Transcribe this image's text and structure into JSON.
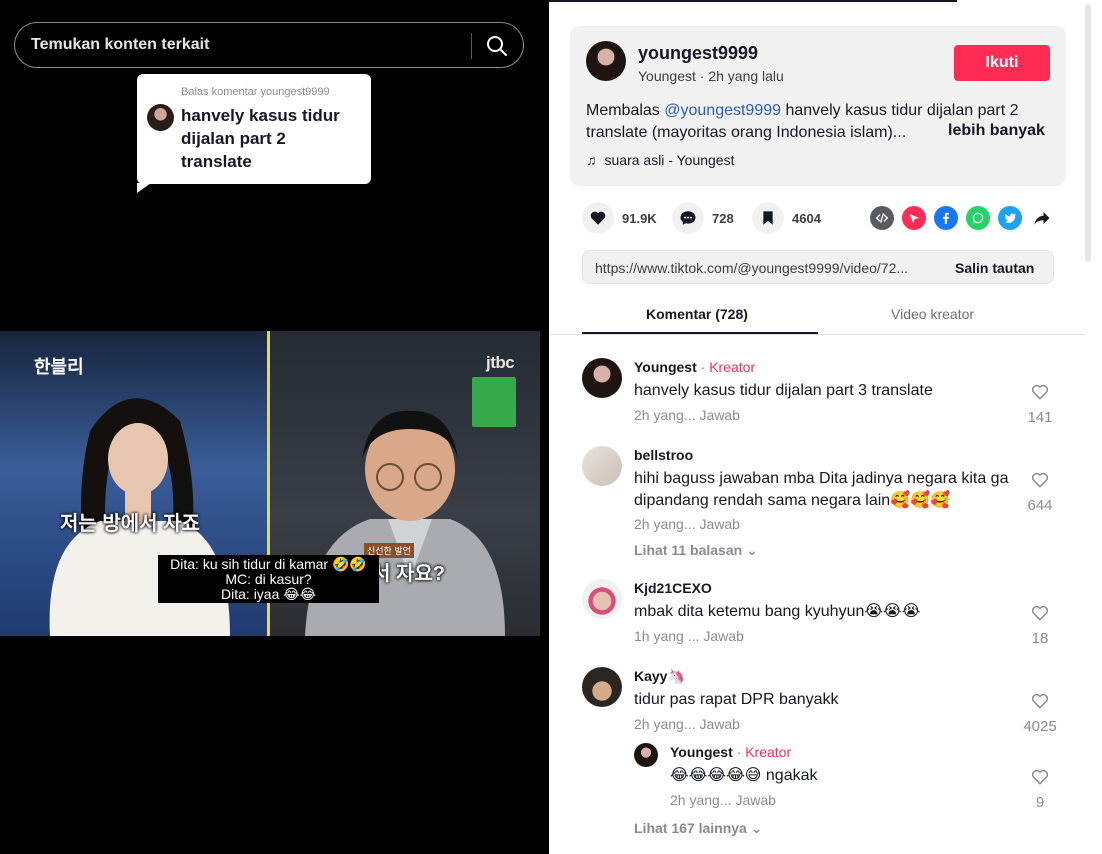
{
  "search": {
    "placeholder": "Temukan konten terkait"
  },
  "video": {
    "reply_card": {
      "header": "Balas komentar youngest9999",
      "text": "hanvely kasus tidur dijalan part 2 translate"
    },
    "overlay": {
      "show_logo": "한블리",
      "channel_logo": "jtbc",
      "korean_caption_left": "저는 방에서 자죠",
      "korean_caption_right": "서 자요?",
      "korean_tag": "신선한 발언",
      "subtitle_lines": [
        "Dita: ku sih tidur di kamar 🤣🤣",
        "MC: di kasur?",
        "Dita: iyaa 😂😂"
      ]
    }
  },
  "post": {
    "author_name": "youngest9999",
    "author_meta": "Youngest · 2h yang lalu",
    "follow_label": "Ikuti",
    "desc_prefix": "Membalas ",
    "desc_mention": "@youngest9999",
    "desc_rest": " hanvely kasus tidur dijalan part 2 translate (mayoritas orang Indonesia islam)...",
    "more_label": "lebih banyak",
    "music": "suara asli - Youngest",
    "likes": "91.9K",
    "comments": "728",
    "saves": "4604",
    "link_url": "https://www.tiktok.com/@youngest9999/video/72...",
    "copy_label": "Salin tautan"
  },
  "tabs": {
    "comments": "Komentar (728)",
    "creator_videos": "Video kreator"
  },
  "comments": [
    {
      "user": "Youngest",
      "is_creator": true,
      "creator_label": "Kreator",
      "text": "hanvely kasus tidur dijalan part 3 translate",
      "time": "2h yang...",
      "reply_label": "Jawab",
      "likes": "141"
    },
    {
      "user": "bellstroo",
      "is_creator": false,
      "text": "hihi baguss jawaban mba Dita jadinya negara kita ga dipandang rendah sama negara lain🥰🥰🥰",
      "time": "2h yang...",
      "reply_label": "Jawab",
      "likes": "644",
      "view_replies": "Lihat 11 balasan"
    },
    {
      "user": "Kjd21CEXO",
      "is_creator": false,
      "text": "mbak dita ketemu bang kyuhyun😭😭😭",
      "time": "1h yang ...",
      "reply_label": "Jawab",
      "likes": "18"
    },
    {
      "user": "Kayy🦄",
      "is_creator": false,
      "text": "tidur pas rapat DPR banyakk",
      "time": "2h yang...",
      "reply_label": "Jawab",
      "likes": "4025"
    }
  ],
  "nested_reply": {
    "user": "Youngest",
    "creator_label": "Kreator",
    "text": "😂😂😂😂😅 ngakak",
    "time": "2h yang...",
    "reply_label": "Jawab",
    "likes": "9"
  },
  "view_more": "Lihat 167 lainnya",
  "colors": {
    "accent": "#fe2c55",
    "mention": "#2b5db9",
    "muted": "#8a8b91"
  }
}
